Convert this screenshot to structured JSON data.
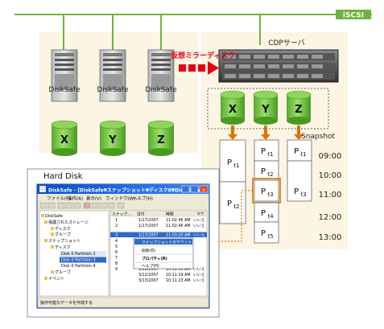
{
  "network": {
    "label": "iSCSI"
  },
  "servers": [
    {
      "label": "DiskSafe",
      "drive": "X"
    },
    {
      "label": "DiskSafe",
      "drive": "Y"
    },
    {
      "label": "DiskSafe",
      "drive": "Z"
    }
  ],
  "cdp": {
    "label": "CDPサーバ",
    "mirror_label": "仮想ミラーディスク",
    "volumes": [
      "X",
      "Y",
      "Z"
    ]
  },
  "snapshot": {
    "title": "Snapshot",
    "times": [
      "09:00",
      "10:00",
      "11:00",
      "12:00",
      "13:00"
    ],
    "col_x": [
      "P",
      "P"
    ],
    "col_x_sub": [
      "t1",
      "t2"
    ],
    "col_y": [
      "P",
      "P",
      "P",
      "P",
      "P"
    ],
    "col_y_sub": [
      "t1",
      "t2",
      "t3",
      "t4",
      "t5"
    ],
    "col_z": [
      "P",
      "P"
    ],
    "col_z_sub": [
      "t1",
      "t3"
    ]
  },
  "hard_disk": {
    "label": "Hard Disk",
    "window_title": "DiskSafe - [DiskSafe¥スナップショット¥ディスク0¥Disk 0 Par...",
    "menu": [
      "ファイル(F)",
      "操作(A)",
      "表示(V)",
      "ウィンドウ(W)",
      "ヘルプ(H)"
    ],
    "tree": [
      "DiskSafe",
      "保護されたストレージ",
      "ディスク",
      "グループ",
      "スナップショット",
      "ディスク",
      "Disk 0 Partition 2",
      "Disk 0 Partition 3",
      "Disk 0 Partition 4",
      "グループ",
      "イベント"
    ],
    "list_headers": [
      "スナップ...",
      "日付",
      "時間",
      "マウ"
    ],
    "list_rows": [
      {
        "num": "1",
        "date": "1/17/2007",
        "time": "11:02:46 AM",
        "mnt": "いいえ"
      },
      {
        "num": "2",
        "date": "1/17/2007",
        "time": "11:02:46 AM",
        "mnt": "いいえ"
      },
      {
        "num": "3",
        "date": "1/17/2007",
        "time": "11:03:20 AM",
        "mnt": "いいえ"
      },
      {
        "num": "4",
        "date": "",
        "time": "",
        "mnt": ""
      },
      {
        "num": "5",
        "date": "",
        "time": "",
        "mnt": ""
      },
      {
        "num": "6",
        "date": "",
        "time": "",
        "mnt": ""
      },
      {
        "num": "7",
        "date": "1/17/2007",
        "time": "",
        "mnt": ""
      },
      {
        "num": "8",
        "date": "1/17/2007",
        "time": "",
        "mnt": ""
      },
      {
        "num": "9",
        "date": "3/12/2007",
        "time": "10:11:19 AM",
        "mnt": "いいえ"
      },
      {
        "num": "",
        "date": "3/12/2007",
        "time": "10:11:19 AM",
        "mnt": "いいえ"
      },
      {
        "num": "",
        "date": "3/13/2007",
        "time": "10:11:23 AM",
        "mnt": "いいえ"
      }
    ],
    "context_menu": [
      "スナップショットのマウント",
      "削除(D)",
      "プロパティ(R)",
      "ヘルプ(H)"
    ],
    "status": "操作可能なデータを作成する"
  },
  "colors": {
    "accent_green": "#6db33f",
    "cylinder_green": "#6cbf3a",
    "arrow_orange": "#e07000",
    "mirror_red": "#e60012",
    "panel_beige": "#fdf5e4",
    "highlight_box": "#e07000"
  }
}
